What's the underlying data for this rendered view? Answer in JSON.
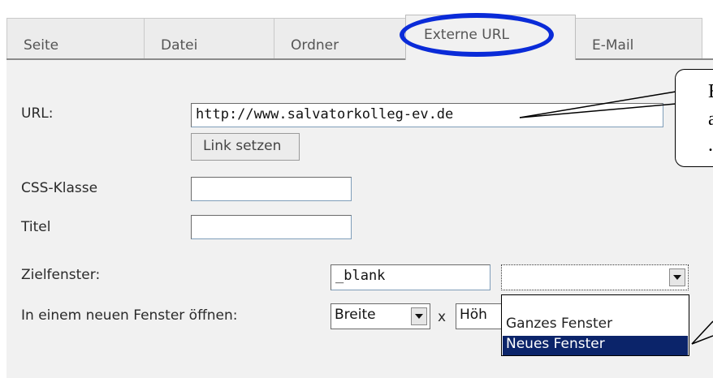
{
  "tabs": [
    {
      "label": "Seite"
    },
    {
      "label": "Datei"
    },
    {
      "label": "Ordner"
    },
    {
      "label": "Externe URL"
    },
    {
      "label": "E-Mail"
    }
  ],
  "form": {
    "url_label": "URL:",
    "url_value": "http://www.salvatorkolleg-ev.de",
    "link_button": "Link setzen",
    "css_label": "CSS-Klasse",
    "css_value": "",
    "title_label": "Titel",
    "title_value": "",
    "target_label": "Zielfenster:",
    "target_value": "_blank",
    "target_select_value": "",
    "new_window_label": "In einem neuen Fenster öffnen:",
    "width_select": "Breite",
    "x_label": "x",
    "height_select": "Höh"
  },
  "dropdown_options": [
    {
      "label": "Ganzes Fenster",
      "selected": false
    },
    {
      "label": "Neues Fenster",
      "selected": true
    }
  ],
  "callouts": {
    "top_text_line1": "E",
    "top_text_line2": "a",
    "top_text_line3": "."
  },
  "colors": {
    "highlight_oval": "#0a2bd8",
    "selected_option": "#0b246a"
  }
}
